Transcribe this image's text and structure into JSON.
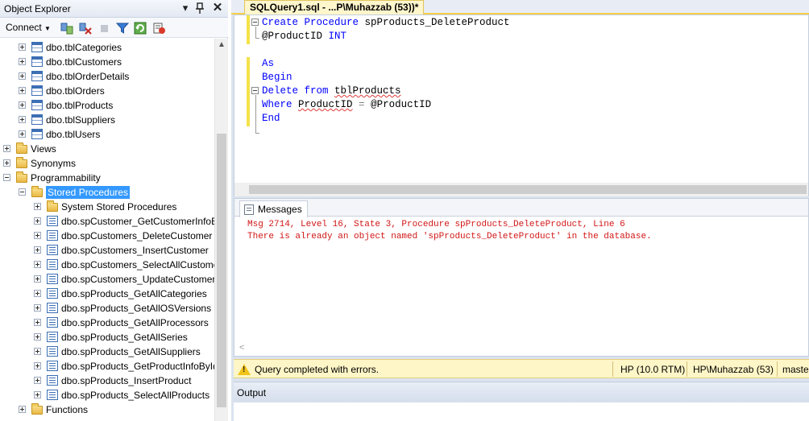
{
  "object_explorer": {
    "title": "Object Explorer",
    "pin_glyph": " ‖",
    "dropdown_glyph": "▾",
    "close_glyph": "✕",
    "toolbar": {
      "connect_label": "Connect"
    },
    "tree": [
      {
        "indent": 1,
        "expander": "plus",
        "icon": "table",
        "label": "dbo.tblCategories"
      },
      {
        "indent": 1,
        "expander": "plus",
        "icon": "table",
        "label": "dbo.tblCustomers"
      },
      {
        "indent": 1,
        "expander": "plus",
        "icon": "table",
        "label": "dbo.tblOrderDetails"
      },
      {
        "indent": 1,
        "expander": "plus",
        "icon": "table",
        "label": "dbo.tblOrders"
      },
      {
        "indent": 1,
        "expander": "plus",
        "icon": "table",
        "label": "dbo.tblProducts"
      },
      {
        "indent": 1,
        "expander": "plus",
        "icon": "table",
        "label": "dbo.tblSuppliers"
      },
      {
        "indent": 1,
        "expander": "plus",
        "icon": "table",
        "label": "dbo.tblUsers"
      },
      {
        "indent": 0,
        "expander": "plus",
        "icon": "folder",
        "label": "Views"
      },
      {
        "indent": 0,
        "expander": "plus",
        "icon": "folder",
        "label": "Synonyms"
      },
      {
        "indent": 0,
        "expander": "minus",
        "icon": "folder",
        "label": "Programmability"
      },
      {
        "indent": 1,
        "expander": "minus",
        "icon": "folder",
        "label": "Stored Procedures",
        "selected": true
      },
      {
        "indent": 2,
        "expander": "plus",
        "icon": "folder",
        "label": "System Stored Procedures"
      },
      {
        "indent": 2,
        "expander": "plus",
        "icon": "proc",
        "label": "dbo.spCustomer_GetCustomerInfoB"
      },
      {
        "indent": 2,
        "expander": "plus",
        "icon": "proc",
        "label": "dbo.spCustomers_DeleteCustomer"
      },
      {
        "indent": 2,
        "expander": "plus",
        "icon": "proc",
        "label": "dbo.spCustomers_InsertCustomer"
      },
      {
        "indent": 2,
        "expander": "plus",
        "icon": "proc",
        "label": "dbo.spCustomers_SelectAllCustome"
      },
      {
        "indent": 2,
        "expander": "plus",
        "icon": "proc",
        "label": "dbo.spCustomers_UpdateCustomer"
      },
      {
        "indent": 2,
        "expander": "plus",
        "icon": "proc",
        "label": "dbo.spProducts_GetAllCategories"
      },
      {
        "indent": 2,
        "expander": "plus",
        "icon": "proc",
        "label": "dbo.spProducts_GetAllOSVersions"
      },
      {
        "indent": 2,
        "expander": "plus",
        "icon": "proc",
        "label": "dbo.spProducts_GetAllProcessors"
      },
      {
        "indent": 2,
        "expander": "plus",
        "icon": "proc",
        "label": "dbo.spProducts_GetAllSeries"
      },
      {
        "indent": 2,
        "expander": "plus",
        "icon": "proc",
        "label": "dbo.spProducts_GetAllSuppliers"
      },
      {
        "indent": 2,
        "expander": "plus",
        "icon": "proc",
        "label": "dbo.spProducts_GetProductInfoById"
      },
      {
        "indent": 2,
        "expander": "plus",
        "icon": "proc",
        "label": "dbo.spProducts_InsertProduct"
      },
      {
        "indent": 2,
        "expander": "plus",
        "icon": "proc",
        "label": "dbo.spProducts_SelectAllProducts"
      },
      {
        "indent": 1,
        "expander": "plus",
        "icon": "folder",
        "label": "Functions"
      }
    ]
  },
  "editor": {
    "tab_title": "SQLQuery1.sql - ...P\\Muhazzab (53))*",
    "code": {
      "l1_kw": "Create Procedure",
      "l1_rest": " spProducts_DeleteProduct",
      "l2_param": "@ProductID ",
      "l2_type": "INT",
      "l4_kw": "As",
      "l5_kw": "Begin",
      "l6_kw": "Delete from",
      "l6_sp": " ",
      "l6_obj": "tblProducts",
      "l7_kw": "Where",
      "l7_sp": " ",
      "l7_col": "ProductID",
      "l7_eq": " = ",
      "l7_param": "@ProductID",
      "l8_kw": "End"
    }
  },
  "results": {
    "tab_label": "Messages",
    "error_line1": "Msg 2714, Level 16, State 3, Procedure spProducts_DeleteProduct, Line 6",
    "error_line2": "There is already an object named 'spProducts_DeleteProduct' in the database.",
    "error_color": "#d21515"
  },
  "status_bar": {
    "message": "Query completed with errors.",
    "server": "HP (10.0 RTM)",
    "user": "HP\\Muhazzab (53)",
    "database": "master"
  },
  "output": {
    "title": "Output"
  }
}
